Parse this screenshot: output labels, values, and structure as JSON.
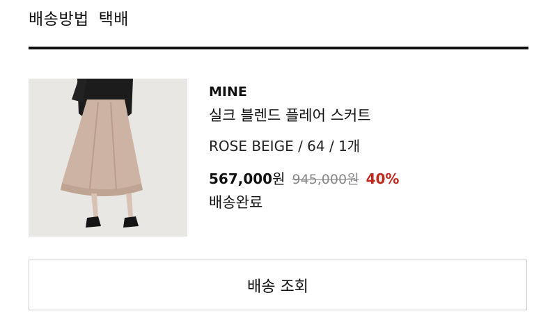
{
  "delivery": {
    "method_label": "배송방법",
    "method_value": "택배"
  },
  "product": {
    "brand": "MINE",
    "name": "실크 블렌드 플레어 스커트",
    "option": "ROSE BEIGE / 64 / 1개",
    "price": {
      "sale_amount": "567,000",
      "sale_unit": "원",
      "original": "945,000원",
      "discount": "40%"
    },
    "status": "배송완료",
    "image_icon": "skirt-product-photo"
  },
  "actions": {
    "track_label": "배송 조회"
  },
  "colors": {
    "accent_discount": "#c0281e",
    "divider": "#111111",
    "button_border": "#cfcfcf",
    "skirt": "#cdb3a4"
  }
}
